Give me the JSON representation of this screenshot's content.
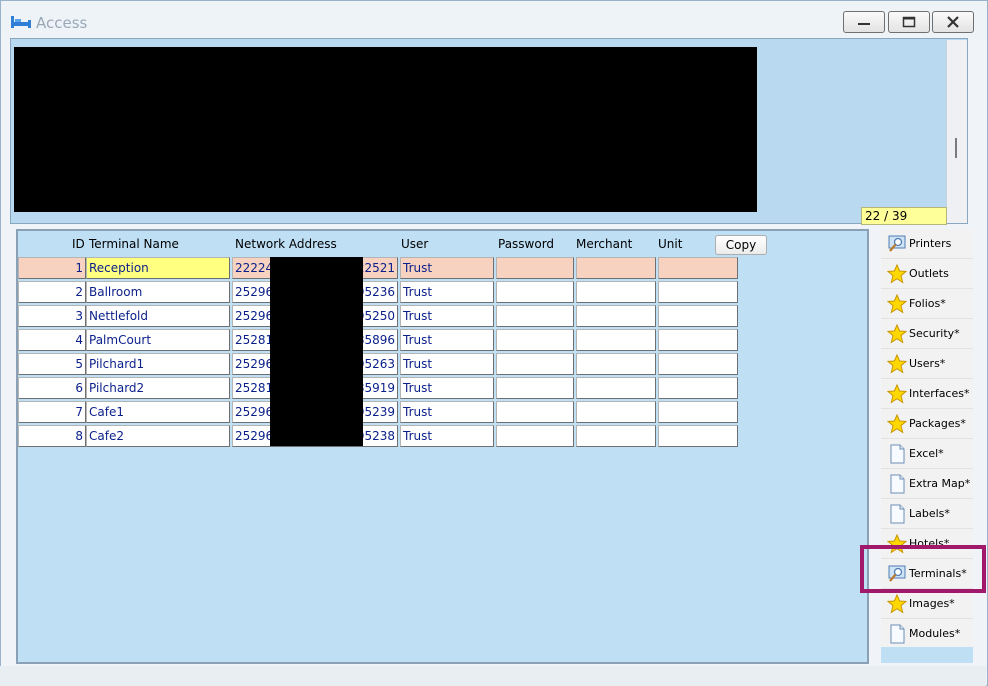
{
  "window": {
    "title": "Access",
    "controls": {
      "minimize": "minimize-icon",
      "maximize": "maximize-icon",
      "close": "close-icon"
    }
  },
  "counter": "22 / 39",
  "table": {
    "headers": {
      "id": "ID",
      "name": "Terminal Name",
      "net": "Network Address",
      "user": "User",
      "password": "Password",
      "merchant": "Merchant",
      "unit": "Unit"
    },
    "copy_label": "Copy",
    "rows": [
      {
        "id": "1",
        "name": "Reception",
        "net_start": "22224",
        "net_end": "22521",
        "user": "Trust",
        "password": "",
        "merchant": "",
        "unit": ""
      },
      {
        "id": "2",
        "name": "Ballroom",
        "net_start": "25296",
        "net_end": "95236",
        "user": "Trust",
        "password": "",
        "merchant": "",
        "unit": ""
      },
      {
        "id": "3",
        "name": "Nettlefold",
        "net_start": "25296",
        "net_end": "95250",
        "user": "Trust",
        "password": "",
        "merchant": "",
        "unit": ""
      },
      {
        "id": "4",
        "name": "PalmCourt",
        "net_start": "25281",
        "net_end": "85896",
        "user": "Trust",
        "password": "",
        "merchant": "",
        "unit": ""
      },
      {
        "id": "5",
        "name": "Pilchard1",
        "net_start": "25296",
        "net_end": "95263",
        "user": "Trust",
        "password": "",
        "merchant": "",
        "unit": ""
      },
      {
        "id": "6",
        "name": "Pilchard2",
        "net_start": "25281",
        "net_end": "85919",
        "user": "Trust",
        "password": "",
        "merchant": "",
        "unit": ""
      },
      {
        "id": "7",
        "name": "Cafe1",
        "net_start": "25296",
        "net_end": "95239",
        "user": "Trust",
        "password": "",
        "merchant": "",
        "unit": ""
      },
      {
        "id": "8",
        "name": "Cafe2",
        "net_start": "25296",
        "net_end": "95238",
        "user": "Trust",
        "password": "",
        "merchant": "",
        "unit": ""
      }
    ]
  },
  "sidebar": {
    "items": [
      {
        "label": "Printers",
        "icon": "search-doc-icon"
      },
      {
        "label": "Outlets",
        "icon": "star-icon"
      },
      {
        "label": "Folios*",
        "icon": "star-icon"
      },
      {
        "label": "Security*",
        "icon": "star-icon"
      },
      {
        "label": "Users*",
        "icon": "star-icon"
      },
      {
        "label": "Interfaces*",
        "icon": "star-icon"
      },
      {
        "label": "Packages*",
        "icon": "star-icon"
      },
      {
        "label": "Excel*",
        "icon": "document-icon"
      },
      {
        "label": "Extra Map*",
        "icon": "document-icon"
      },
      {
        "label": "Labels*",
        "icon": "document-icon"
      },
      {
        "label": "Hotels*",
        "icon": "star-icon"
      },
      {
        "label": "Terminals*",
        "icon": "search-doc-icon"
      },
      {
        "label": "Images*",
        "icon": "star-icon"
      },
      {
        "label": "Modules*",
        "icon": "document-icon"
      }
    ]
  },
  "colors": {
    "panel_blue": "#bfdff5",
    "selected_row": "#f7d2c0",
    "selected_name": "#ffff80",
    "highlight_box": "#a0196a",
    "counter_bg": "#ffff99",
    "cell_text": "#0a1f8a"
  }
}
